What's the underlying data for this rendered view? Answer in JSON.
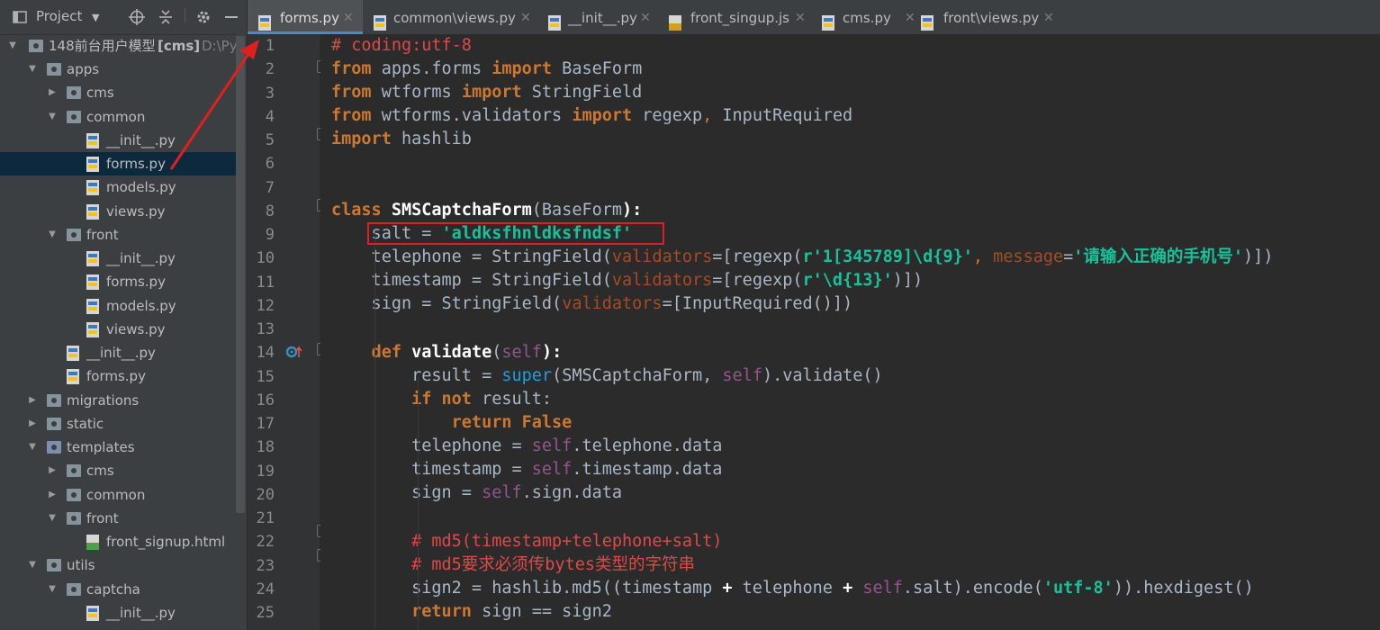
{
  "project_panel": {
    "title": "Project",
    "root": {
      "label": "148前台用户模型",
      "module": "[cms]",
      "path": "D:\\Pych"
    },
    "tree": [
      {
        "label": "apps",
        "kind": "folder",
        "open": true
      },
      {
        "label": "cms",
        "kind": "folder",
        "open": false
      },
      {
        "label": "common",
        "kind": "folder",
        "open": true
      },
      {
        "label": "__init__.py",
        "kind": "py"
      },
      {
        "label": "forms.py",
        "kind": "py",
        "selected": true
      },
      {
        "label": "models.py",
        "kind": "py"
      },
      {
        "label": "views.py",
        "kind": "py"
      },
      {
        "label": "front",
        "kind": "folder",
        "open": true
      },
      {
        "label": "__init__.py",
        "kind": "py"
      },
      {
        "label": "forms.py",
        "kind": "py"
      },
      {
        "label": "models.py",
        "kind": "py"
      },
      {
        "label": "views.py",
        "kind": "py"
      },
      {
        "label": "__init__.py",
        "kind": "py"
      },
      {
        "label": "forms.py",
        "kind": "py"
      },
      {
        "label": "migrations",
        "kind": "folder",
        "open": false
      },
      {
        "label": "static",
        "kind": "folder",
        "open": false
      },
      {
        "label": "templates",
        "kind": "folder",
        "open": true
      },
      {
        "label": "cms",
        "kind": "folder",
        "open": false
      },
      {
        "label": "common",
        "kind": "folder",
        "open": false
      },
      {
        "label": "front",
        "kind": "folder",
        "open": true
      },
      {
        "label": "front_signup.html",
        "kind": "html"
      },
      {
        "label": "utils",
        "kind": "folder",
        "open": true
      },
      {
        "label": "captcha",
        "kind": "folder",
        "open": true
      },
      {
        "label": "__init__.py",
        "kind": "py"
      }
    ]
  },
  "tabs": [
    {
      "label": "forms.py",
      "active": true
    },
    {
      "label": "common\\views.py"
    },
    {
      "label": "__init__.py"
    },
    {
      "label": "front_singup.js"
    },
    {
      "label": "cms.py"
    },
    {
      "label": "front\\views.py"
    }
  ],
  "line_numbers": [
    "1",
    "2",
    "3",
    "4",
    "5",
    "6",
    "7",
    "8",
    "9",
    "10",
    "11",
    "12",
    "13",
    "14",
    "15",
    "16",
    "17",
    "18",
    "19",
    "20",
    "21",
    "22",
    "23",
    "24",
    "25"
  ],
  "code": {
    "l1": "# coding:utf-8",
    "kw_from": "from",
    "kw_import": "import",
    "kw_class": "class",
    "kw_def": "def",
    "kw_if": "if",
    "kw_not": "not",
    "kw_return": "return",
    "kw_false": "False",
    "l2_mod": " apps.forms ",
    "l2_name": " BaseForm",
    "l3_mod": " wtforms ",
    "l3_name": " StringField",
    "l4_mod": " wtforms.validators ",
    "l4_name1": " regexp",
    "l4_comma": ",",
    "l4_name2": " InputRequired",
    "l5_mod": " hashlib",
    "l8_name": "SMSCaptchaForm",
    "l8_open": "(",
    "l8_base": "BaseForm",
    "l8_close": "):",
    "l9_a": "    salt = ",
    "l9_str": "'aldksfhnldksfndsf'",
    "l10_a": "    telephone = StringField(",
    "l10_param": "validators",
    "l10_b": "=[regexp(",
    "l10_str1": "r'1[345789]\\d{9}'",
    "l10_c": ", ",
    "l10_param2": "message",
    "l10_d": "=",
    "l10_str2": "'请输入正确的手机号'",
    "l10_e": ")])",
    "l11_a": "    timestamp = StringField(",
    "l11_param": "validators",
    "l11_b": "=[regexp(",
    "l11_str": "r'\\d{13}'",
    "l11_c": ")])",
    "l12_a": "    sign = StringField(",
    "l12_param": "validators",
    "l12_b": "=[InputRequired()])",
    "l14_a": "    ",
    "l14_name": "validate",
    "l14_b": "(",
    "l14_self": "self",
    "l14_c": "):",
    "l15_a": "        result = ",
    "l15_super": "super",
    "l15_b": "(SMSCaptchaForm, ",
    "l15_self": "self",
    "l15_c": ").validate()",
    "l16_a": "        ",
    "l16_b": " result:",
    "l17_a": "            ",
    "l18_a": "        telephone = ",
    "l18_self": "self",
    "l18_b": ".telephone.data",
    "l19_a": "        timestamp = ",
    "l19_self": "self",
    "l19_b": ".timestamp.data",
    "l20_a": "        sign = ",
    "l20_self": "self",
    "l20_b": ".sign.data",
    "l22": "        # md5(timestamp+telephone+salt)",
    "l23": "        # md5要求必须传bytes类型的字符串",
    "l24_a": "        sign2 = hashlib.md5((timestamp ",
    "l24_plus1": "+",
    "l24_b": " telephone ",
    "l24_plus2": "+",
    "l24_c": " ",
    "l24_self": "self",
    "l24_d": ".salt).encode(",
    "l24_str": "'utf-8'",
    "l24_e": ")).hexdigest()",
    "l25_a": "        ",
    "l25_b": " sign == sign2"
  },
  "colors": {
    "annotation_red": "#e02020",
    "accent": "#4a88c7"
  }
}
